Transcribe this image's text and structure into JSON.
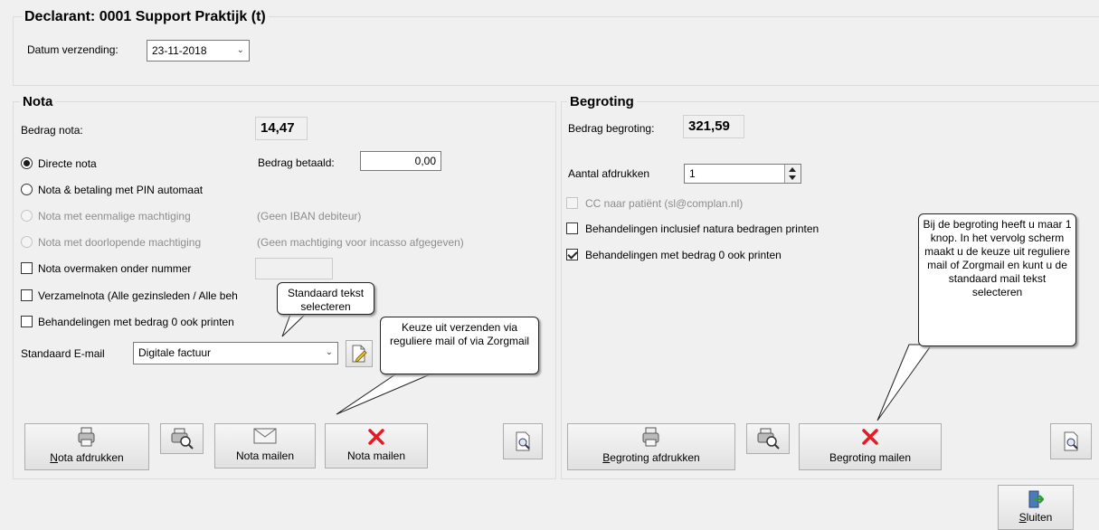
{
  "header": {
    "title": "Declarant: 0001 Support Praktijk (t)",
    "datum_label": "Datum verzending:",
    "datum_value": "23-11-2018"
  },
  "nota": {
    "title": "Nota",
    "bedrag_label": "Bedrag nota:",
    "bedrag_value": "14,47",
    "betaald_label": "Bedrag betaald:",
    "betaald_value": "0,00",
    "options": [
      {
        "label": "Directe nota",
        "checked": true,
        "enabled": true
      },
      {
        "label": "Nota & betaling met PIN automaat",
        "checked": false,
        "enabled": true
      },
      {
        "label": "Nota met eenmalige machtiging",
        "checked": false,
        "enabled": false
      },
      {
        "label": "Nota met doorlopende machtiging",
        "checked": false,
        "enabled": false
      }
    ],
    "iban_note": "(Geen IBAN debiteur)",
    "machtiging_note": "(Geen machtiging voor incasso afgegeven)",
    "overmaken_label": "Nota overmaken onder nummer",
    "verzamel_label": "Verzamelnota (Alle gezinsleden / Alle beh",
    "nul_label": "Behandelingen met bedrag 0 ook printen",
    "email_label": "Standaard E-mail",
    "email_value": "Digitale factuur",
    "btn_afdrukken_pre": "N",
    "btn_afdrukken_rest": "ota afdrukken",
    "btn_mailen1": "Nota mailen",
    "btn_mailen2": "Nota mailen"
  },
  "begroting": {
    "title": "Begroting",
    "bedrag_label": "Bedrag begroting:",
    "bedrag_value": "321,59",
    "afdrukken_label": "Aantal afdrukken",
    "afdrukken_value": "1",
    "cc_label": "CC naar patiënt (sl@complan.nl)",
    "natura_label": "Behandelingen inclusief natura bedragen printen",
    "nul_label": "Behandelingen met bedrag 0 ook printen",
    "btn_afdrukken_pre": "B",
    "btn_afdrukken_rest": "egroting afdrukken",
    "btn_mailen": "Begroting mailen"
  },
  "callouts": {
    "standaard": "Standaard tekst selecteren",
    "keuze": "Keuze uit verzenden via reguliere mail of via Zorgmail",
    "begroting": "Bij de begroting heeft u maar 1 knop. In het vervolg scherm maakt u de keuze uit reguliere mail of Zorgmail en kunt u de standaard mail tekst selecteren"
  },
  "footer": {
    "sluiten_pre": "S",
    "sluiten_rest": "luiten"
  },
  "colors": {
    "window_bg": "#f0f0f0",
    "accent_red": "#e31b23"
  }
}
